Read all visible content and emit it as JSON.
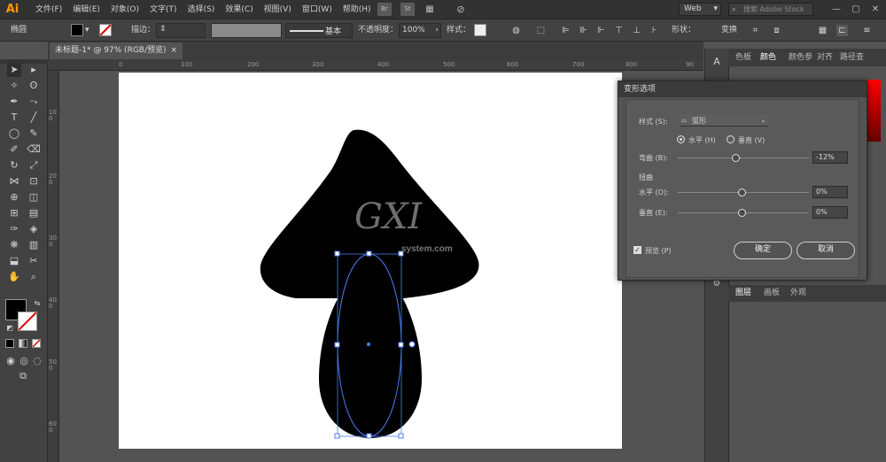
{
  "app": {
    "logo": "Ai"
  },
  "menu": [
    "文件(F)",
    "编辑(E)",
    "对象(O)",
    "文字(T)",
    "选择(S)",
    "效果(C)",
    "视图(V)",
    "窗口(W)",
    "帮助(H)"
  ],
  "menu_icons": {
    "bridge": "Br",
    "stock": "St"
  },
  "workspace": "Web",
  "search": {
    "placeholder": "搜索 Adobe Stock"
  },
  "control_bar": {
    "selection": "椭圆",
    "stroke_label": "描边：",
    "stroke_style": "基本",
    "opacity_label": "不透明度：",
    "opacity_value": "100%",
    "style_label": "样式：",
    "shape_label": "形状：",
    "transform_label": "变换"
  },
  "document": {
    "tab_title": "未标题-1* @ 97% (RGB/预览)",
    "close": "×"
  },
  "rulers": {
    "h": [
      "0",
      "100",
      "200",
      "300",
      "400",
      "500",
      "600",
      "700",
      "800",
      "90"
    ],
    "v": [
      "100",
      "200",
      "300",
      "400",
      "500",
      "600"
    ]
  },
  "dialog": {
    "title": "变形选项",
    "style_label": "样式 (S):",
    "style_value": "弧形",
    "horizontal": "水平 (H)",
    "vertical": "垂直 (V)",
    "orientation_selected": "horizontal",
    "bend_label": "弯曲 (B):",
    "bend_value": "-12%",
    "bend_fraction": 0.44,
    "distortion_label": "扭曲",
    "h_label": "水平 (O):",
    "h_value": "0%",
    "v_label": "垂直 (E):",
    "v_value": "0%",
    "preview_label": "预览 (P)",
    "preview_checked": true,
    "ok": "确定",
    "cancel": "取消"
  },
  "right_panel": {
    "tabs": [
      "色板",
      "颜色",
      "颜色参",
      "对齐",
      "路径查"
    ],
    "layer_tabs": [
      "图层",
      "画板",
      "外观"
    ]
  },
  "watermark": {
    "line1": "GXI",
    "line2": "system.com"
  },
  "colors": {
    "accent": "#4c7cf5",
    "shape": "#000000",
    "artboard": "#ffffff"
  }
}
